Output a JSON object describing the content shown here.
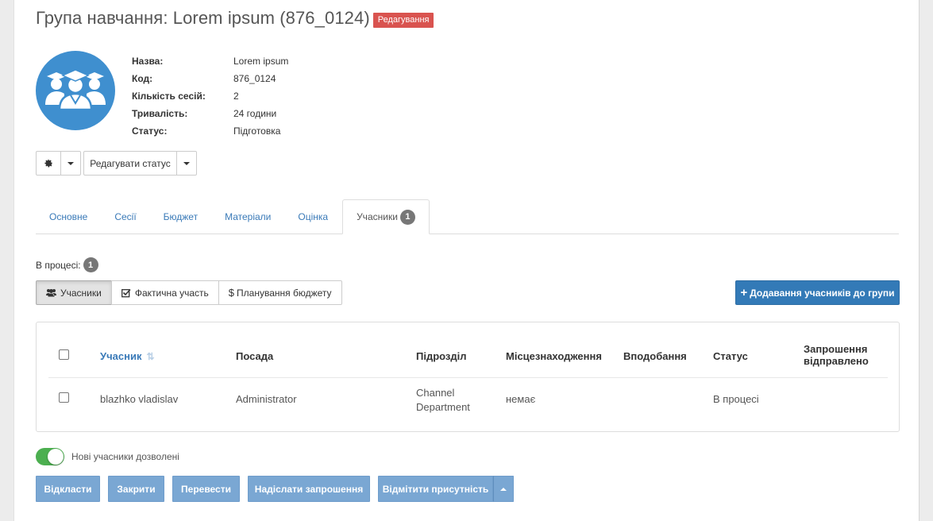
{
  "header": {
    "title": "Група навчання: Lorem ipsum (876_0124)",
    "badge": "Редагування"
  },
  "info": [
    {
      "label": "Назва:",
      "value": "Lorem ipsum"
    },
    {
      "label": "Код:",
      "value": "876_0124"
    },
    {
      "label": "Кількість сесій:",
      "value": "2"
    },
    {
      "label": "Тривалість:",
      "value": "24 години"
    },
    {
      "label": "Статус:",
      "value": "Підготовка"
    }
  ],
  "actions": {
    "edit_status": "Редагувати статус"
  },
  "tabs": [
    {
      "label": "Основне"
    },
    {
      "label": "Сесії"
    },
    {
      "label": "Бюджет"
    },
    {
      "label": "Матеріали"
    },
    {
      "label": "Оцінка"
    },
    {
      "label": "Учасники",
      "count": "1"
    }
  ],
  "in_process": {
    "label": "В процесі:",
    "count": "1"
  },
  "segments": [
    {
      "label": "Учасники"
    },
    {
      "label": "Фактична участь"
    },
    {
      "label": "Планування бюджету"
    }
  ],
  "add_button": "Додавання учасників до групи",
  "table": {
    "headers": [
      "Учасник",
      "Посада",
      "Підрозділ",
      "Місцезнаходження",
      "Вподобання",
      "Статус",
      "Запрошення",
      "відправлено"
    ],
    "rows": [
      {
        "name": "blazhko vladislav",
        "position": "Administrator",
        "dept_line1": "Channel",
        "dept_line2": "Department",
        "location": "немає",
        "preference": "",
        "status": "В процесі",
        "invitation": ""
      }
    ]
  },
  "toggle": {
    "label": "Нові учасники дозволені"
  },
  "bottom_buttons": [
    {
      "label": "Відкласти"
    },
    {
      "label": "Закрити"
    },
    {
      "label": "Перевести"
    },
    {
      "label": "Надіслати запрошення"
    },
    {
      "label": "Відмітити присутність"
    }
  ],
  "colors": {
    "primary": "#337ab7",
    "badge_red": "#d9534f",
    "avatar_blue": "#3f8fcf",
    "toggle_green": "#4caf50",
    "muted_button": "#7aa7d3"
  }
}
